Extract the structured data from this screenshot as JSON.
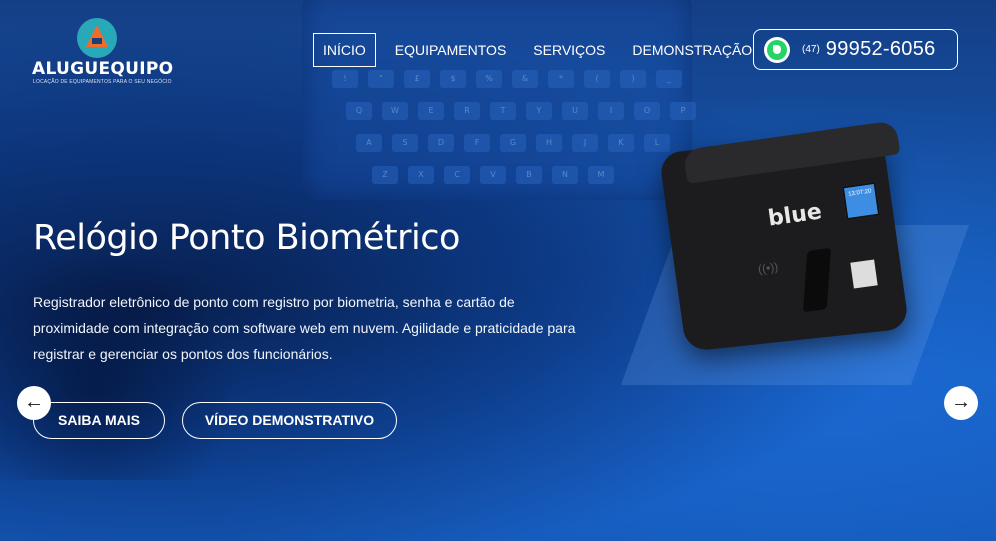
{
  "brand": {
    "name": "ALUGUEQUIPO",
    "tagline": "LOCAÇÃO DE EQUIPAMENTOS PARA O SEU NEGÓCIO"
  },
  "nav": {
    "items": [
      {
        "label": "INÍCIO",
        "active": true
      },
      {
        "label": "EQUIPAMENTOS",
        "active": false
      },
      {
        "label": "SERVIÇOS",
        "active": false
      },
      {
        "label": "DEMONSTRAÇÃO",
        "active": false
      }
    ]
  },
  "contact": {
    "icon": "whatsapp-icon",
    "area_code": "(47)",
    "number": "99952-6056"
  },
  "slide": {
    "title": "Relógio Ponto Biométrico",
    "description": "Registrador eletrônico de ponto com registro por biometria, senha e cartão de proximidade com integração com software web em nuvem. Agilidade e praticidade para registrar e gerenciar os pontos dos funcionários.",
    "buttons": {
      "more": "SAIBA MAIS",
      "video": "VÍDEO DEMONSTRATIVO"
    },
    "product_brand": "blue",
    "screen_time": "13:07:20"
  },
  "carousel": {
    "prev_icon": "arrow-left-icon",
    "next_icon": "arrow-right-icon"
  },
  "colors": {
    "background": "#1557b0",
    "whatsapp": "#25d366",
    "logo_teal": "#29a9b8",
    "logo_orange": "#f26b2a"
  }
}
